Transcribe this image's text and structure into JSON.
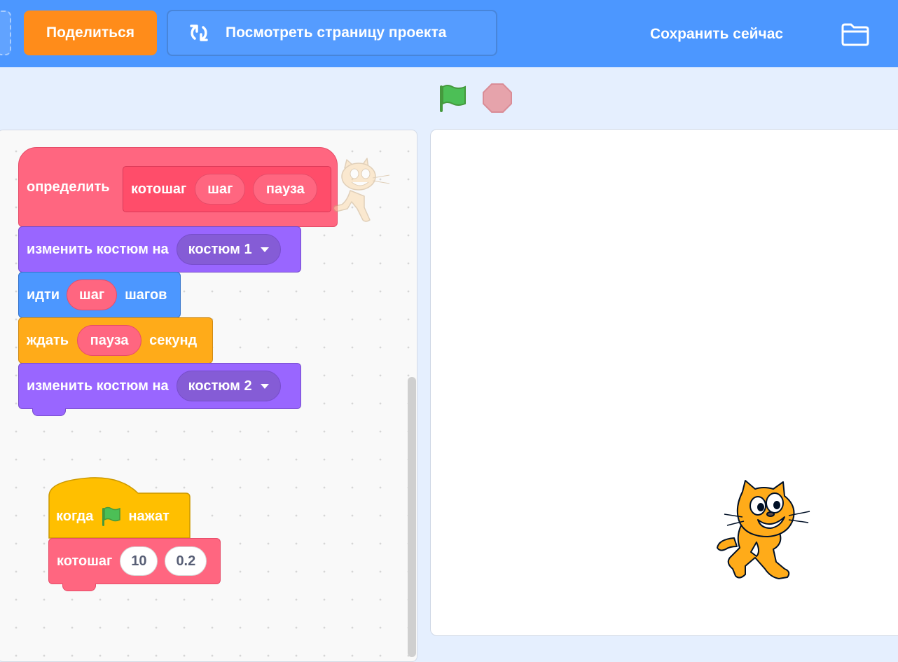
{
  "menubar": {
    "share_label": "Поделиться",
    "project_page_label": "Посмотреть страницу проекта",
    "save_now_label": "Сохранить сейчас",
    "background_color": "#4c97ff",
    "share_color": "#ff8c1a",
    "icons": [
      "remix-icon",
      "folder-icon"
    ]
  },
  "stage_controls": {
    "icons": [
      "green-flag-icon",
      "stop-icon"
    ]
  },
  "script_define": {
    "define_label": "определить",
    "proto_name": "котошаг",
    "param_1": "шаг",
    "param_2": "пауза",
    "blocks": [
      {
        "category": "looks",
        "label": "изменить костюм на",
        "dropdown": "костюм 1"
      },
      {
        "category": "motion",
        "label_before": "идти",
        "input": "шаг",
        "label_after": "шагов"
      },
      {
        "category": "control",
        "label_before": "ждать",
        "input": "пауза",
        "label_after": "секунд"
      },
      {
        "category": "looks",
        "label": "изменить костюм на",
        "dropdown": "костюм 2"
      }
    ]
  },
  "script_flag": {
    "hat_before": "когда",
    "hat_after": "нажат",
    "call_name": "котошаг",
    "arg_1": "10",
    "arg_2": "0.2"
  },
  "colors": {
    "looks": "#9966ff",
    "motion": "#4c97ff",
    "control": "#ffab19",
    "events": "#ffbf00",
    "custom": "#ff6680"
  }
}
